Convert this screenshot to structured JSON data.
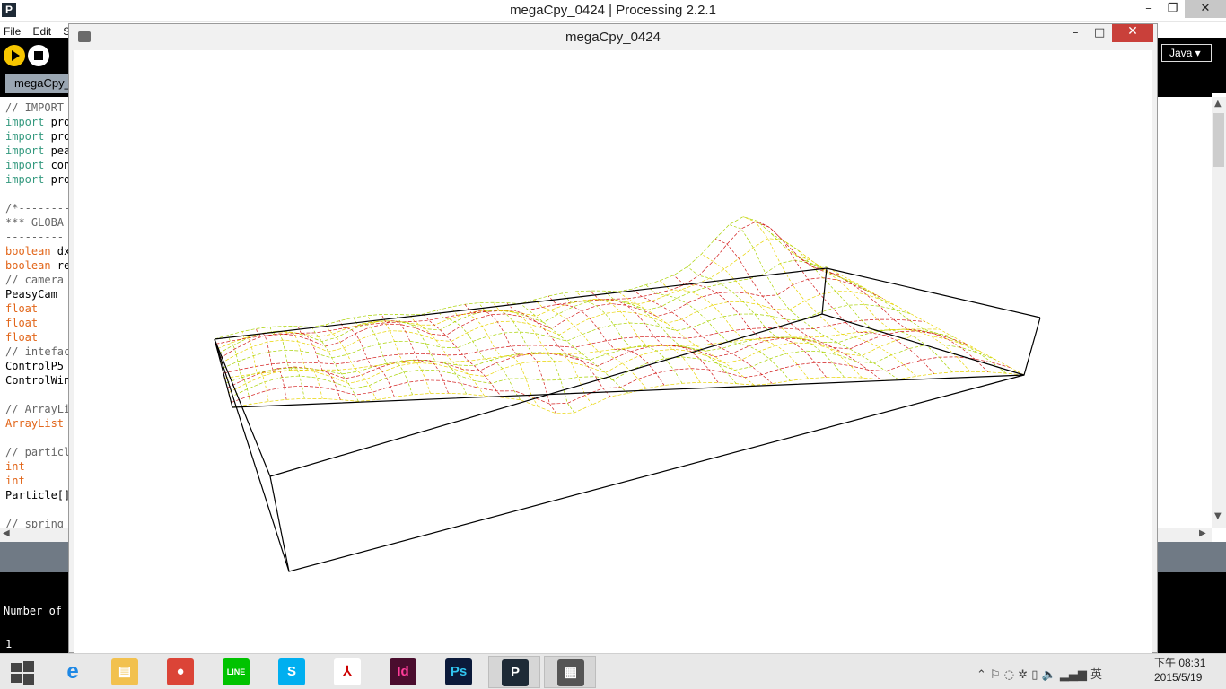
{
  "ide": {
    "title": "megaCpy_0424 | Processing 2.2.1",
    "logo": "P",
    "controls": [
      "–",
      "❐",
      "✕"
    ],
    "menus": [
      "File",
      "Edit",
      "Sk"
    ],
    "mode": "Java ▾",
    "tab_label": "megaCpy_",
    "code_lines": [
      {
        "text": "// IMPORT",
        "kind": "comment"
      },
      {
        "kw": "import",
        "rest": " pro",
        "kind": "import"
      },
      {
        "kw": "import",
        "rest": " pro",
        "kind": "import"
      },
      {
        "kw": "import",
        "rest": " pea",
        "kind": "import"
      },
      {
        "kw": "import",
        "rest": " con",
        "kind": "import"
      },
      {
        "kw": "import",
        "rest": " pro",
        "kind": "import"
      },
      {
        "text": "",
        "kind": "blank"
      },
      {
        "text": "/*--------",
        "kind": "comment"
      },
      {
        "text": " *** GLOBA",
        "kind": "comment"
      },
      {
        "text": " ---------",
        "kind": "comment"
      },
      {
        "kw": "boolean",
        "rest": " dx",
        "kind": "type"
      },
      {
        "kw": "boolean",
        "rest": " re",
        "kind": "type"
      },
      {
        "text": "// camera",
        "kind": "comment"
      },
      {
        "text": "PeasyCam",
        "kind": "plain"
      },
      {
        "kw": "float",
        "rest": "",
        "kind": "type"
      },
      {
        "kw": "float",
        "rest": "",
        "kind": "type"
      },
      {
        "kw": "float",
        "rest": "",
        "kind": "type"
      },
      {
        "text": "// intefac",
        "kind": "comment"
      },
      {
        "text": "ControlP5",
        "kind": "plain"
      },
      {
        "text": "ControlWin",
        "kind": "plain"
      },
      {
        "text": "",
        "kind": "blank"
      },
      {
        "text": "// ArrayLi",
        "kind": "comment"
      },
      {
        "kw": "ArrayList",
        "rest": "",
        "kind": "type"
      },
      {
        "text": "",
        "kind": "blank"
      },
      {
        "text": "// particl",
        "kind": "comment"
      },
      {
        "kw": "int",
        "rest": "",
        "kind": "type"
      },
      {
        "kw": "int",
        "rest": "",
        "kind": "type"
      },
      {
        "text": "Particle[]",
        "kind": "plain"
      },
      {
        "text": "",
        "kind": "blank"
      },
      {
        "text": "// spring",
        "kind": "comment"
      }
    ],
    "console_text": "Number of ",
    "line_number": "1"
  },
  "sketch": {
    "title": "megaCpy_0424",
    "minimize": "–",
    "maximize": "□",
    "close": "✕"
  },
  "taskbar": {
    "apps": [
      {
        "name": "file-explorer-icon",
        "glyph": "▤",
        "color": "#f2c14e"
      },
      {
        "name": "chrome-icon",
        "glyph": "●",
        "color": "#db4437"
      },
      {
        "name": "line-icon",
        "glyph": "LINE",
        "color": "#00c300"
      },
      {
        "name": "skype-icon",
        "glyph": "S",
        "color": "#00aff0"
      },
      {
        "name": "acrobat-icon",
        "glyph": "⅄",
        "color": "#ffffff"
      },
      {
        "name": "indesign-icon",
        "glyph": "Id",
        "color": "#4a0d2e"
      },
      {
        "name": "photoshop-icon",
        "glyph": "Ps",
        "color": "#0b1a3a"
      },
      {
        "name": "processing-icon",
        "glyph": "P",
        "color": "#1e2a36"
      },
      {
        "name": "sketch-window-icon",
        "glyph": "▦",
        "color": "#555555"
      }
    ],
    "tray": "⌃  ⚐  ◌  ✲  ▯  🔈  ▂▄▆  英",
    "time": "下午 08:31",
    "date": "2015/5/19"
  }
}
